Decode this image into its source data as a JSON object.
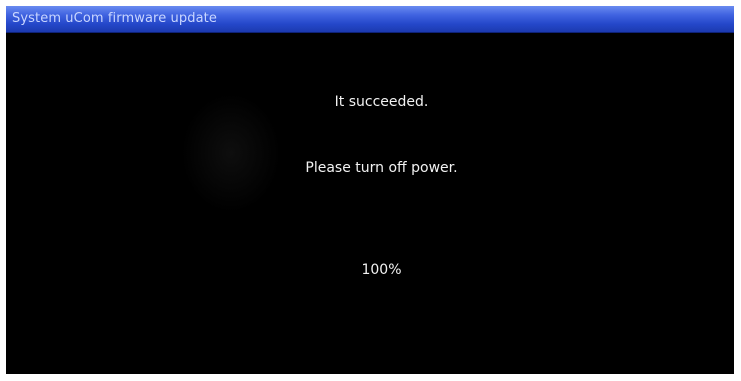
{
  "window": {
    "title": "System uCom firmware update"
  },
  "status": {
    "result_message": "It succeeded.",
    "instruction_message": "Please turn off power.",
    "progress_text": "100%",
    "progress_fraction": 1.0
  },
  "colors": {
    "title_bar": "#2447c9",
    "background": "#000000",
    "text": "#f2f2f2"
  }
}
